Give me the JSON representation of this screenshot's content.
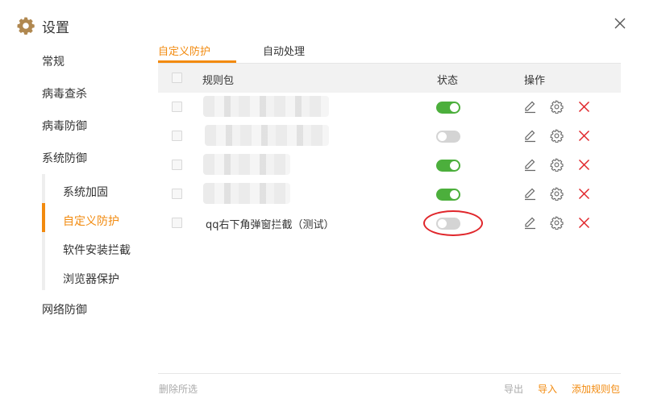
{
  "window": {
    "title": "设置",
    "close_icon": "close-icon"
  },
  "sidebar": {
    "items": [
      "常规",
      "病毒查杀",
      "病毒防御",
      "系统防御",
      "网络防御"
    ],
    "sub_items": [
      "系统加固",
      "自定义防护",
      "软件安装拦截",
      "浏览器保护"
    ],
    "active_sub": "自定义防护"
  },
  "tabs": [
    {
      "label": "自定义防护",
      "active": true
    },
    {
      "label": "自动处理",
      "active": false
    }
  ],
  "table": {
    "columns": {
      "name": "规则包",
      "status": "状态",
      "actions": "操作"
    },
    "rows": [
      {
        "name": "",
        "enabled": true,
        "blurred": true
      },
      {
        "name": "",
        "enabled": false,
        "blurred": true
      },
      {
        "name": "",
        "enabled": true,
        "blurred": true
      },
      {
        "name": "",
        "enabled": true,
        "blurred": true
      },
      {
        "name": "qq右下角弹窗拦截（测试）",
        "enabled": false,
        "blurred": false
      }
    ],
    "row_action_icons": [
      "edit-icon",
      "settings-icon",
      "delete-icon"
    ]
  },
  "footer": {
    "delete_selected": "删除所选",
    "export": "导出",
    "import": "导入",
    "add_rule_pack": "添加规则包"
  },
  "colors": {
    "accent": "#f28a0e",
    "toggle_on": "#4caf3c",
    "toggle_off": "#d4d4d4",
    "delete": "#e0262b",
    "highlight": "#e0262b"
  }
}
